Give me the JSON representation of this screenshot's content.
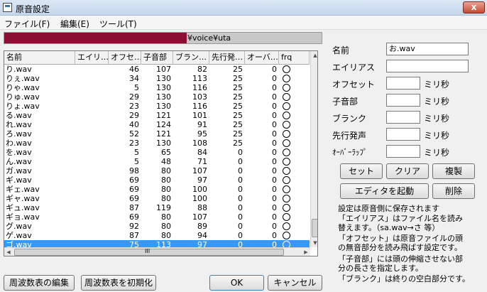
{
  "window": {
    "title": "原音設定",
    "close_label": "x"
  },
  "menu": [
    "ファイル(F)",
    "編集(E)",
    "ツール(T)"
  ],
  "path": {
    "visible_text": "¥voice¥uta"
  },
  "table": {
    "columns": [
      "名前",
      "エイリ…",
      "オフセ…",
      "子音部",
      "ブラン…",
      "先行発…",
      "オーバ…",
      "frq"
    ],
    "rows": [
      [
        "り.wav",
        "",
        "46",
        "107",
        "82",
        "25",
        "0"
      ],
      [
        "りぇ.wav",
        "",
        "34",
        "130",
        "113",
        "25",
        "0"
      ],
      [
        "りゃ.wav",
        "",
        "5",
        "130",
        "116",
        "25",
        "0"
      ],
      [
        "りゅ.wav",
        "",
        "29",
        "130",
        "103",
        "25",
        "0"
      ],
      [
        "りょ.wav",
        "",
        "23",
        "130",
        "116",
        "25",
        "0"
      ],
      [
        "る.wav",
        "",
        "29",
        "121",
        "101",
        "25",
        "0"
      ],
      [
        "れ.wav",
        "",
        "40",
        "124",
        "91",
        "25",
        "0"
      ],
      [
        "ろ.wav",
        "",
        "52",
        "121",
        "95",
        "25",
        "0"
      ],
      [
        "わ.wav",
        "",
        "23",
        "130",
        "108",
        "25",
        "0"
      ],
      [
        "を.wav",
        "",
        "5",
        "65",
        "84",
        "0",
        "0"
      ],
      [
        "ん.wav",
        "",
        "5",
        "48",
        "71",
        "0",
        "0"
      ],
      [
        "ガ.wav",
        "",
        "98",
        "80",
        "107",
        "0",
        "0"
      ],
      [
        "ギ.wav",
        "",
        "69",
        "80",
        "97",
        "0",
        "0"
      ],
      [
        "ギェ.wav",
        "",
        "69",
        "80",
        "100",
        "0",
        "0"
      ],
      [
        "ギャ.wav",
        "",
        "69",
        "80",
        "100",
        "0",
        "0"
      ],
      [
        "ギュ.wav",
        "",
        "87",
        "119",
        "88",
        "0",
        "0"
      ],
      [
        "ギョ.wav",
        "",
        "69",
        "80",
        "107",
        "0",
        "0"
      ],
      [
        "グ.wav",
        "",
        "92",
        "80",
        "89",
        "0",
        "0"
      ],
      [
        "ゲ.wav",
        "",
        "87",
        "80",
        "94",
        "0",
        "0"
      ],
      [
        "ゴ.wav",
        "",
        "75",
        "113",
        "97",
        "0",
        "0"
      ]
    ],
    "selected_index": 19,
    "hscroll_label": "III"
  },
  "form": {
    "name_label": "名前",
    "name_value": "お.wav",
    "alias_label": "エイリアス",
    "alias_value": "",
    "offset_label": "オフセット",
    "consonant_label": "子音部",
    "blank_label": "ブランク",
    "preutter_label": "先行発声",
    "overlap_label": "ｵｰﾊﾞｰﾗｯﾌﾟ",
    "unit": "ミリ秒"
  },
  "buttons": {
    "set": "セット",
    "clear": "クリア",
    "copy": "複製",
    "launch_editor": "エディタを起動",
    "delete": "削除",
    "edit_freq": "周波数表の編集",
    "init_freq": "周波数表を初期化",
    "ok": "OK",
    "cancel": "キャンセル"
  },
  "help_lines": [
    "設定は原音側に保存されます",
    "「エイリアス」はファイル名を読み",
    "替えます。（sa.wav→さ 等）",
    "「オフセット」は原音ファイルの頭",
    "の無音部分を読み飛ばす設定です。",
    "「子音部」には頭の伸縮させない部",
    "分の長さを指定します。",
    "「ブランク」は終りの空白部分です。"
  ],
  "colors": {
    "selection": "#3399ff",
    "path_mask": "#8a0f33",
    "close_button": "#c74a33"
  }
}
